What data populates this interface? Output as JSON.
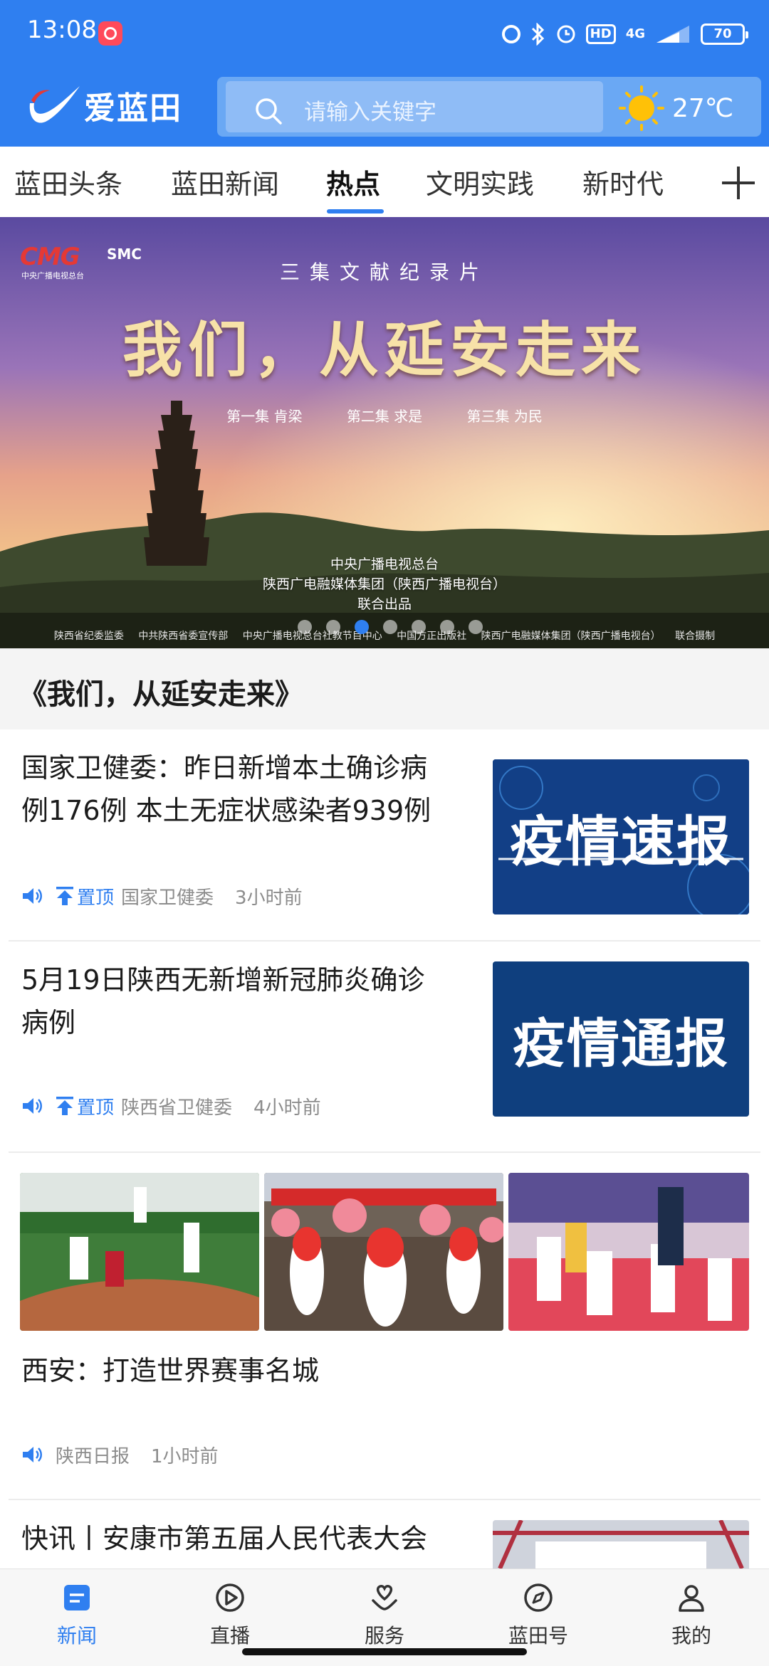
{
  "status_bar": {
    "time": "13:08",
    "network": "4G",
    "hd": "HD",
    "battery": "70"
  },
  "header": {
    "logo_text": "爱蓝田",
    "search_placeholder": "请输入关键字",
    "temperature": "27℃"
  },
  "tabs": {
    "items": [
      "蓝田头条",
      "蓝田新闻",
      "热点",
      "文明实践",
      "新时代"
    ],
    "active": "热点"
  },
  "banner": {
    "brand_left": "CMG",
    "brand_left_sub": "中央广播电视总台",
    "brand_right": "SMC",
    "subtitle": "三集文献纪录片",
    "title": "我们，从延安走来",
    "episodes": [
      "第一集 肯梁",
      "第二集 求是",
      "第三集 为民"
    ],
    "producers": [
      "中央广播电视总台",
      "陕西广电融媒体集团（陕西广播电视台）",
      "联合出品"
    ],
    "partners": [
      "陕西省纪委监委",
      "中共陕西省委宣传部",
      "中央广播电视总台社教节目中心",
      "中国方正出版社",
      "陕西广电融媒体集团（陕西广播电视台）",
      "联合摄制"
    ],
    "caption": "《我们，从延安走来》",
    "dots": 7,
    "active_dot": 2
  },
  "news": [
    {
      "title_line1": "国家卫健委：昨日新增本土确诊病",
      "title_line2": "例176例 本土无症状感染者939例",
      "pinned_label": "置顶",
      "source": "国家卫健委",
      "time": "3小时前",
      "thumb_text": "疫情速报"
    },
    {
      "title_line1": "5月19日陕西无新增新冠肺炎确诊",
      "title_line2": "病例",
      "pinned_label": "置顶",
      "source": "陕西省卫健委",
      "time": "4小时前",
      "thumb_text": "疫情通报"
    },
    {
      "title_line1": "西安：打造世界赛事名城",
      "source": "陕西日报",
      "time": "1小时前"
    },
    {
      "title_line1": "快讯丨安康市第五届人民代表大会"
    }
  ],
  "bottom_nav": {
    "items": [
      "新闻",
      "直播",
      "服务",
      "蓝田号",
      "我的"
    ],
    "active": "新闻"
  },
  "colors": {
    "brand_blue": "#2f7ff0",
    "search_bg": "#8fbcf6",
    "meta_gray": "#8c8c8c"
  }
}
